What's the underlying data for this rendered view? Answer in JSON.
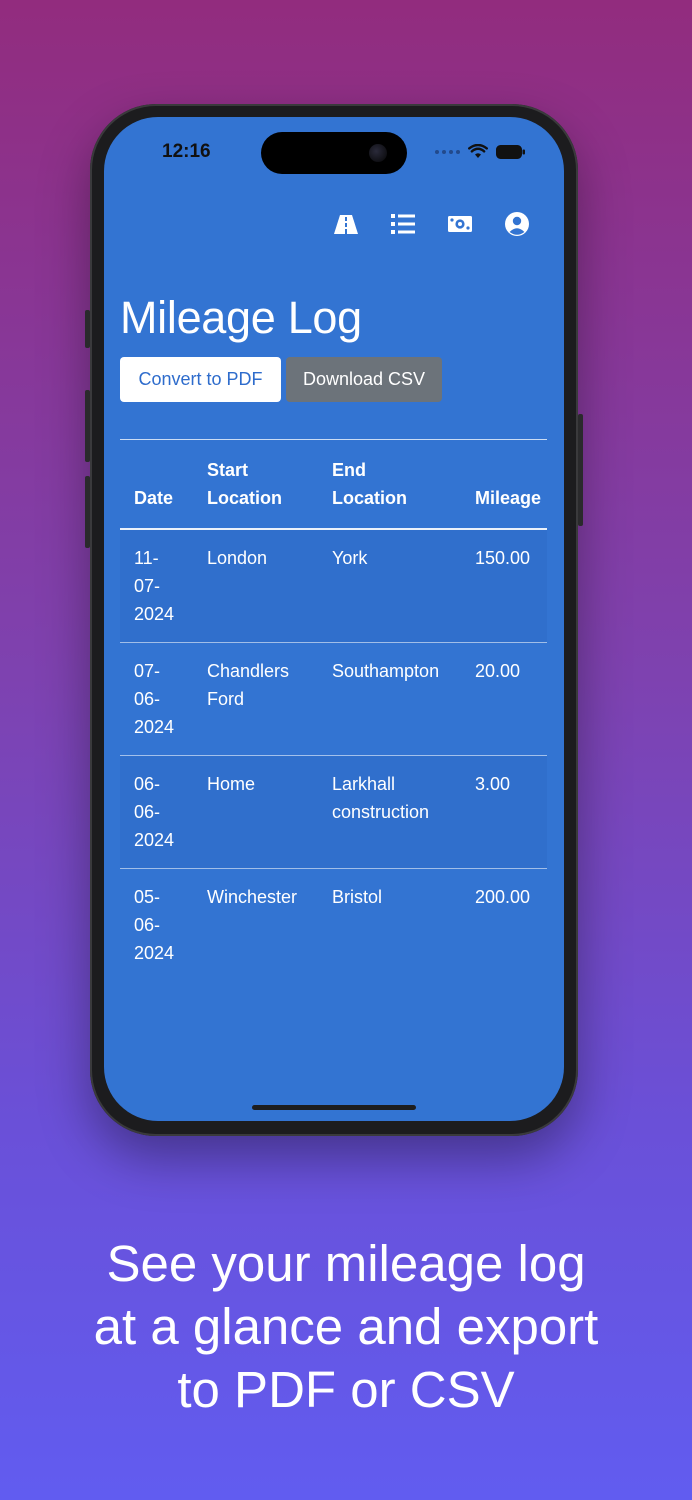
{
  "status_bar": {
    "time": "12:16",
    "icons": [
      "signal-dots-icon",
      "wifi-icon",
      "battery-icon"
    ]
  },
  "nav": {
    "icons": [
      "road-icon",
      "list-icon",
      "money-icon",
      "user-circle-icon"
    ]
  },
  "page": {
    "title": "Mileage Log",
    "convert_pdf_label": "Convert to PDF",
    "download_csv_label": "Download CSV"
  },
  "table": {
    "headers": {
      "date": "Date",
      "start_line1": "Start",
      "start_line2": "Location",
      "end_line1": "End",
      "end_line2": "Location",
      "mileage": "Mileage"
    },
    "rows": [
      {
        "date": [
          "11-",
          "07-",
          "2024"
        ],
        "start": [
          "London"
        ],
        "end": [
          "York"
        ],
        "mileage": "150.00"
      },
      {
        "date": [
          "07-",
          "06-",
          "2024"
        ],
        "start": [
          "Chandlers",
          "Ford"
        ],
        "end": [
          "Southampton"
        ],
        "mileage": "20.00"
      },
      {
        "date": [
          "06-",
          "06-",
          "2024"
        ],
        "start": [
          "Home"
        ],
        "end": [
          "Larkhall",
          "construction"
        ],
        "mileage": "3.00"
      },
      {
        "date": [
          "05-",
          "06-",
          "2024"
        ],
        "start": [
          "Winchester"
        ],
        "end": [
          "Bristol"
        ],
        "mileage": "200.00"
      }
    ]
  },
  "caption": {
    "line1": "See your mileage log",
    "line2": "at a glance and export",
    "line3": "to PDF or CSV"
  },
  "colors": {
    "background_top": "#922c7e",
    "background_bottom": "#615cf0",
    "screen": "#3374d2",
    "pdf_button_text": "#2e6ccc",
    "csv_button_bg": "#6c737a"
  }
}
